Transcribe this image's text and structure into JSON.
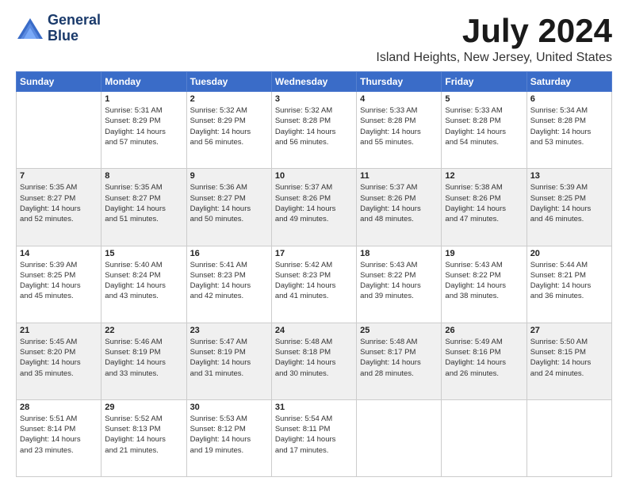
{
  "header": {
    "logo_line1": "General",
    "logo_line2": "Blue",
    "month": "July 2024",
    "location": "Island Heights, New Jersey, United States"
  },
  "days_of_week": [
    "Sunday",
    "Monday",
    "Tuesday",
    "Wednesday",
    "Thursday",
    "Friday",
    "Saturday"
  ],
  "weeks": [
    [
      {
        "day": "",
        "detail": ""
      },
      {
        "day": "1",
        "detail": "Sunrise: 5:31 AM\nSunset: 8:29 PM\nDaylight: 14 hours\nand 57 minutes."
      },
      {
        "day": "2",
        "detail": "Sunrise: 5:32 AM\nSunset: 8:29 PM\nDaylight: 14 hours\nand 56 minutes."
      },
      {
        "day": "3",
        "detail": "Sunrise: 5:32 AM\nSunset: 8:28 PM\nDaylight: 14 hours\nand 56 minutes."
      },
      {
        "day": "4",
        "detail": "Sunrise: 5:33 AM\nSunset: 8:28 PM\nDaylight: 14 hours\nand 55 minutes."
      },
      {
        "day": "5",
        "detail": "Sunrise: 5:33 AM\nSunset: 8:28 PM\nDaylight: 14 hours\nand 54 minutes."
      },
      {
        "day": "6",
        "detail": "Sunrise: 5:34 AM\nSunset: 8:28 PM\nDaylight: 14 hours\nand 53 minutes."
      }
    ],
    [
      {
        "day": "7",
        "detail": "Sunrise: 5:35 AM\nSunset: 8:27 PM\nDaylight: 14 hours\nand 52 minutes."
      },
      {
        "day": "8",
        "detail": "Sunrise: 5:35 AM\nSunset: 8:27 PM\nDaylight: 14 hours\nand 51 minutes."
      },
      {
        "day": "9",
        "detail": "Sunrise: 5:36 AM\nSunset: 8:27 PM\nDaylight: 14 hours\nand 50 minutes."
      },
      {
        "day": "10",
        "detail": "Sunrise: 5:37 AM\nSunset: 8:26 PM\nDaylight: 14 hours\nand 49 minutes."
      },
      {
        "day": "11",
        "detail": "Sunrise: 5:37 AM\nSunset: 8:26 PM\nDaylight: 14 hours\nand 48 minutes."
      },
      {
        "day": "12",
        "detail": "Sunrise: 5:38 AM\nSunset: 8:26 PM\nDaylight: 14 hours\nand 47 minutes."
      },
      {
        "day": "13",
        "detail": "Sunrise: 5:39 AM\nSunset: 8:25 PM\nDaylight: 14 hours\nand 46 minutes."
      }
    ],
    [
      {
        "day": "14",
        "detail": "Sunrise: 5:39 AM\nSunset: 8:25 PM\nDaylight: 14 hours\nand 45 minutes."
      },
      {
        "day": "15",
        "detail": "Sunrise: 5:40 AM\nSunset: 8:24 PM\nDaylight: 14 hours\nand 43 minutes."
      },
      {
        "day": "16",
        "detail": "Sunrise: 5:41 AM\nSunset: 8:23 PM\nDaylight: 14 hours\nand 42 minutes."
      },
      {
        "day": "17",
        "detail": "Sunrise: 5:42 AM\nSunset: 8:23 PM\nDaylight: 14 hours\nand 41 minutes."
      },
      {
        "day": "18",
        "detail": "Sunrise: 5:43 AM\nSunset: 8:22 PM\nDaylight: 14 hours\nand 39 minutes."
      },
      {
        "day": "19",
        "detail": "Sunrise: 5:43 AM\nSunset: 8:22 PM\nDaylight: 14 hours\nand 38 minutes."
      },
      {
        "day": "20",
        "detail": "Sunrise: 5:44 AM\nSunset: 8:21 PM\nDaylight: 14 hours\nand 36 minutes."
      }
    ],
    [
      {
        "day": "21",
        "detail": "Sunrise: 5:45 AM\nSunset: 8:20 PM\nDaylight: 14 hours\nand 35 minutes."
      },
      {
        "day": "22",
        "detail": "Sunrise: 5:46 AM\nSunset: 8:19 PM\nDaylight: 14 hours\nand 33 minutes."
      },
      {
        "day": "23",
        "detail": "Sunrise: 5:47 AM\nSunset: 8:19 PM\nDaylight: 14 hours\nand 31 minutes."
      },
      {
        "day": "24",
        "detail": "Sunrise: 5:48 AM\nSunset: 8:18 PM\nDaylight: 14 hours\nand 30 minutes."
      },
      {
        "day": "25",
        "detail": "Sunrise: 5:48 AM\nSunset: 8:17 PM\nDaylight: 14 hours\nand 28 minutes."
      },
      {
        "day": "26",
        "detail": "Sunrise: 5:49 AM\nSunset: 8:16 PM\nDaylight: 14 hours\nand 26 minutes."
      },
      {
        "day": "27",
        "detail": "Sunrise: 5:50 AM\nSunset: 8:15 PM\nDaylight: 14 hours\nand 24 minutes."
      }
    ],
    [
      {
        "day": "28",
        "detail": "Sunrise: 5:51 AM\nSunset: 8:14 PM\nDaylight: 14 hours\nand 23 minutes."
      },
      {
        "day": "29",
        "detail": "Sunrise: 5:52 AM\nSunset: 8:13 PM\nDaylight: 14 hours\nand 21 minutes."
      },
      {
        "day": "30",
        "detail": "Sunrise: 5:53 AM\nSunset: 8:12 PM\nDaylight: 14 hours\nand 19 minutes."
      },
      {
        "day": "31",
        "detail": "Sunrise: 5:54 AM\nSunset: 8:11 PM\nDaylight: 14 hours\nand 17 minutes."
      },
      {
        "day": "",
        "detail": ""
      },
      {
        "day": "",
        "detail": ""
      },
      {
        "day": "",
        "detail": ""
      }
    ]
  ]
}
